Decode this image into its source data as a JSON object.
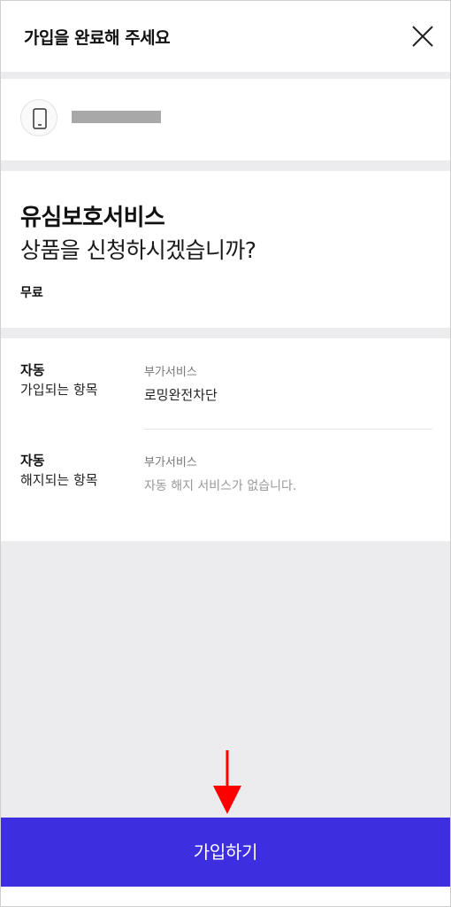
{
  "header": {
    "title": "가입을 완료해 주세요",
    "close_icon": "close-icon"
  },
  "phone": {
    "icon": "smartphone-icon",
    "number_masked": true
  },
  "product": {
    "name": "유심보호서비스",
    "question": "상품을 신청하시겠습니까?",
    "price": "무료"
  },
  "details": {
    "auto_join": {
      "label_strong": "자동",
      "label_plain": "가입되는 항목",
      "category": "부가서비스",
      "value": "로밍완전차단"
    },
    "auto_cancel": {
      "label_strong": "자동",
      "label_plain": "해지되는 항목",
      "category": "부가서비스",
      "value": "자동 해지 서비스가 없습니다."
    }
  },
  "annotation": {
    "arrow_icon": "red-arrow-down-icon",
    "arrow_color": "#ff0000"
  },
  "action": {
    "join_label": "가입하기",
    "button_color": "#3d2fe0"
  }
}
